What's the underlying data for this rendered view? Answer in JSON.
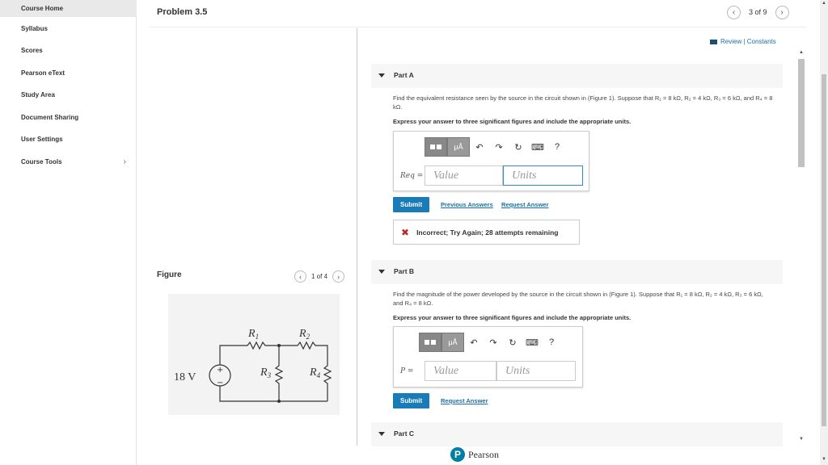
{
  "sidebar": {
    "items": [
      {
        "label": "Course Home"
      },
      {
        "label": "Syllabus"
      },
      {
        "label": "Scores"
      },
      {
        "label": "Pearson eText"
      },
      {
        "label": "Study Area"
      },
      {
        "label": "Document Sharing"
      },
      {
        "label": "User Settings"
      },
      {
        "label": "Course Tools",
        "chevron": "›"
      }
    ]
  },
  "header": {
    "title": "Problem 3.5",
    "pager": "3 of 9",
    "prev_icon": "‹",
    "next_icon": "›"
  },
  "review": {
    "label": "Review | Constants"
  },
  "figure": {
    "label": "Figure",
    "pager": "1 of 4",
    "source_label": "18 V",
    "plus": "+",
    "minus": "−",
    "r1": "R",
    "r1_sub": "1",
    "r2": "R",
    "r2_sub": "2",
    "r3": "R",
    "r3_sub": "3",
    "r4": "R",
    "r4_sub": "4"
  },
  "partA": {
    "title": "Part A",
    "question": "Find the equivalent resistance seen by the source in the circuit shown in (Figure 1). Suppose that R₁ = 8 kΩ, R₂ = 4 kΩ, R₃ = 6 kΩ, and R₄ = 8 kΩ.",
    "instruction": "Express your answer to three significant figures and include the appropriate units.",
    "field_label": "Req =",
    "value_placeholder": "Value",
    "units_placeholder": "Units",
    "submit": "Submit",
    "previous_answers": "Previous Answers",
    "request_answer": "Request Answer",
    "feedback_icon": "✖",
    "feedback": "Incorrect; Try Again; 28 attempts remaining"
  },
  "partB": {
    "title": "Part B",
    "question": "Find the magnitude of the power developed by the source in the circuit shown in (Figure 1). Suppose that R₁ = 8 kΩ, R₂ = 4 kΩ, R₃ = 6 kΩ, and R₄ = 8 kΩ.",
    "instruction": "Express your answer to three significant figures and include the appropriate units.",
    "field_label": "P =",
    "value_placeholder": "Value",
    "units_placeholder": "Units",
    "submit": "Submit",
    "request_answer": "Request Answer"
  },
  "partC": {
    "title": "Part C"
  },
  "toolbar": {
    "mu": "μÅ",
    "undo": "↶",
    "redo": "↷",
    "reset": "↻",
    "keyboard": "⌨",
    "help": "?"
  },
  "footer": {
    "brand": "Pearson",
    "logo_letter": "P"
  },
  "colors": {
    "accent": "#1a7bb9",
    "error": "#c0272d"
  }
}
